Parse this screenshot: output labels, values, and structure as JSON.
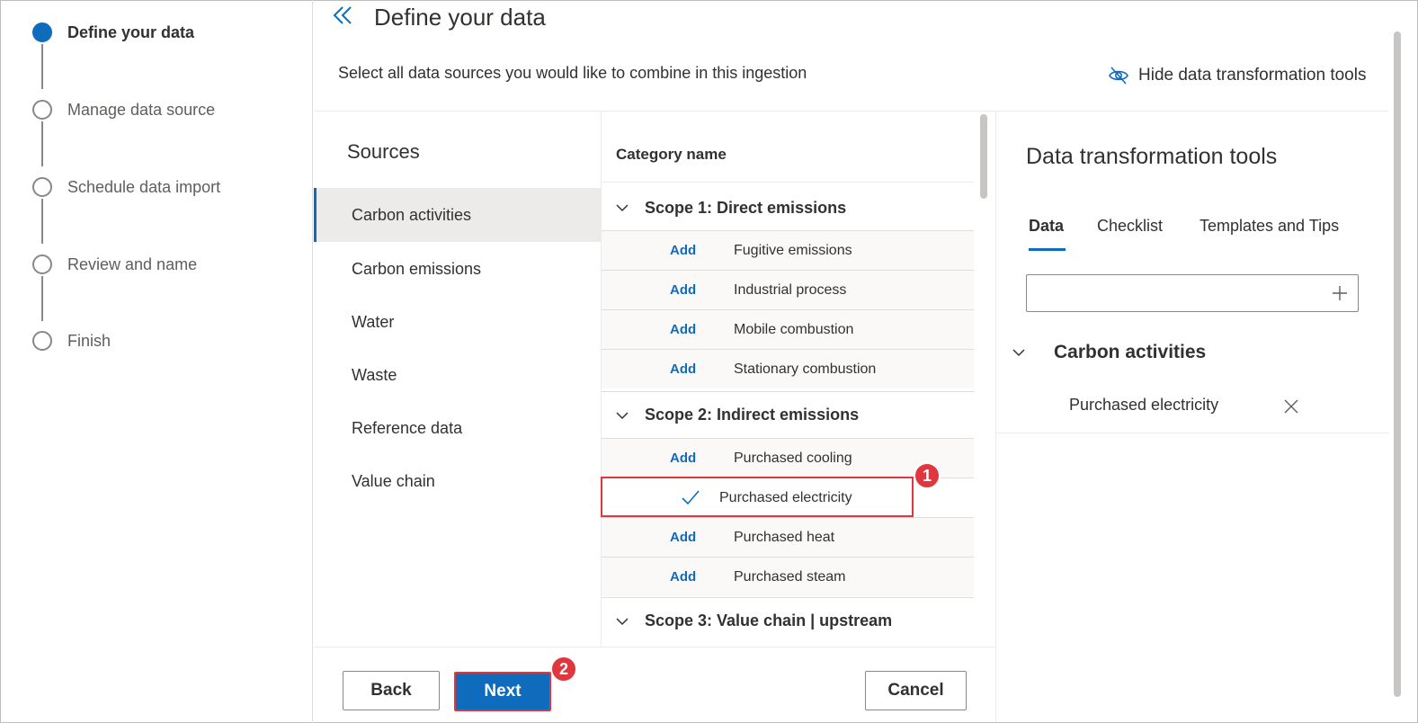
{
  "stepper": [
    {
      "label": "Define your data",
      "state": "active"
    },
    {
      "label": "Manage data source",
      "state": "pending"
    },
    {
      "label": "Schedule data import",
      "state": "pending"
    },
    {
      "label": "Review and name",
      "state": "pending"
    },
    {
      "label": "Finish",
      "state": "pending"
    }
  ],
  "header": {
    "title": "Define your data",
    "subtitle": "Select all data sources you would like to combine in this ingestion",
    "hide_tools_label": "Hide data transformation tools"
  },
  "sources": {
    "title": "Sources",
    "selected": "Carbon activities",
    "items": [
      "Carbon activities",
      "Carbon emissions",
      "Water",
      "Waste",
      "Reference data",
      "Value chain"
    ]
  },
  "categories": {
    "header": "Category name",
    "add_label": "Add",
    "scopes": [
      {
        "label": "Scope 1: Direct emissions",
        "items": [
          {
            "name": "Fugitive emissions",
            "checked": false
          },
          {
            "name": "Industrial process",
            "checked": false
          },
          {
            "name": "Mobile combustion",
            "checked": false
          },
          {
            "name": "Stationary combustion",
            "checked": false
          }
        ]
      },
      {
        "label": "Scope 2: Indirect emissions",
        "items": [
          {
            "name": "Purchased cooling",
            "checked": false
          },
          {
            "name": "Purchased electricity",
            "checked": true
          },
          {
            "name": "Purchased heat",
            "checked": false
          },
          {
            "name": "Purchased steam",
            "checked": false
          }
        ]
      },
      {
        "label": "Scope 3: Value chain | upstream",
        "items": []
      }
    ]
  },
  "callouts": {
    "one": "1",
    "two": "2"
  },
  "footer": {
    "back_label": "Back",
    "next_label": "Next",
    "cancel_label": "Cancel"
  },
  "tools": {
    "title": "Data transformation tools",
    "tabs": [
      "Data",
      "Checklist",
      "Templates and Tips"
    ],
    "active_tab": "Data",
    "input_value": "",
    "group_label": "Carbon activities",
    "selected_item": "Purchased electricity"
  },
  "colors": {
    "accent": "#0f6cbd",
    "callout": "#e0373f"
  }
}
